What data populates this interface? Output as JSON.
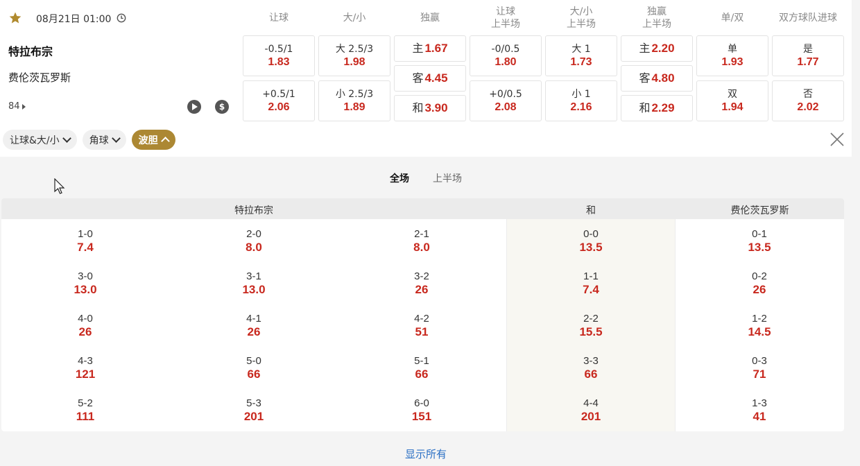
{
  "match": {
    "datetime": "08月21日 01:00",
    "home": "特拉布宗",
    "away": "费伦茨瓦罗斯",
    "markets_count": "84"
  },
  "columns": [
    {
      "l1": "让球",
      "l2": ""
    },
    {
      "l1": "大/小",
      "l2": ""
    },
    {
      "l1": "独赢",
      "l2": ""
    },
    {
      "l1": "让球",
      "l2": "上半场"
    },
    {
      "l1": "大/小",
      "l2": "上半场"
    },
    {
      "l1": "独赢",
      "l2": "上半场"
    },
    {
      "l1": "单/双",
      "l2": ""
    },
    {
      "l1": "双方球队进球",
      "l2": ""
    }
  ],
  "odds": {
    "handicap_full": [
      {
        "label": "-0.5/1",
        "value": "1.83"
      },
      {
        "label": "+0.5/1",
        "value": "2.06"
      }
    ],
    "ou_full": [
      {
        "label": "大 2.5/3",
        "value": "1.98"
      },
      {
        "label": "小 2.5/3",
        "value": "1.89"
      }
    ],
    "1x2_full": [
      {
        "label": "主",
        "value": "1.67"
      },
      {
        "label": "客",
        "value": "4.45"
      },
      {
        "label": "和",
        "value": "3.90"
      }
    ],
    "handicap_half": [
      {
        "label": "-0/0.5",
        "value": "1.80"
      },
      {
        "label": "+0/0.5",
        "value": "2.08"
      }
    ],
    "ou_half": [
      {
        "label": "大 1",
        "value": "1.73"
      },
      {
        "label": "小 1",
        "value": "2.16"
      }
    ],
    "1x2_half": [
      {
        "label": "主",
        "value": "2.20"
      },
      {
        "label": "客",
        "value": "4.80"
      },
      {
        "label": "和",
        "value": "2.29"
      }
    ],
    "odd_even": [
      {
        "label": "单",
        "value": "1.93"
      },
      {
        "label": "双",
        "value": "1.94"
      }
    ],
    "btts": [
      {
        "label": "是",
        "value": "1.77"
      },
      {
        "label": "否",
        "value": "2.02"
      }
    ]
  },
  "filters": [
    "让球&大/小",
    "角球",
    "波胆"
  ],
  "subtabs": [
    "全场",
    "上半场"
  ],
  "table": {
    "home_header": "特拉布宗",
    "draw_header": "和",
    "away_header": "费伦茨瓦罗斯",
    "rows": [
      [
        {
          "s": "1-0",
          "o": "7.4"
        },
        {
          "s": "2-0",
          "o": "8.0"
        },
        {
          "s": "2-1",
          "o": "8.0"
        },
        {
          "s": "0-0",
          "o": "13.5"
        },
        {
          "s": "0-1",
          "o": "13.5"
        }
      ],
      [
        {
          "s": "3-0",
          "o": "13.0"
        },
        {
          "s": "3-1",
          "o": "13.0"
        },
        {
          "s": "3-2",
          "o": "26"
        },
        {
          "s": "1-1",
          "o": "7.4"
        },
        {
          "s": "0-2",
          "o": "26"
        }
      ],
      [
        {
          "s": "4-0",
          "o": "26"
        },
        {
          "s": "4-1",
          "o": "26"
        },
        {
          "s": "4-2",
          "o": "51"
        },
        {
          "s": "2-2",
          "o": "15.5"
        },
        {
          "s": "1-2",
          "o": "14.5"
        }
      ],
      [
        {
          "s": "4-3",
          "o": "121"
        },
        {
          "s": "5-0",
          "o": "66"
        },
        {
          "s": "5-1",
          "o": "66"
        },
        {
          "s": "3-3",
          "o": "66"
        },
        {
          "s": "0-3",
          "o": "71"
        }
      ],
      [
        {
          "s": "5-2",
          "o": "111"
        },
        {
          "s": "5-3",
          "o": "201"
        },
        {
          "s": "6-0",
          "o": "151"
        },
        {
          "s": "4-4",
          "o": "201"
        },
        {
          "s": "1-3",
          "o": "41"
        }
      ]
    ]
  },
  "show_all": "显示所有",
  "colors": {
    "accent": "#ac8833",
    "odds": "#c8281e",
    "link": "#2a6fc4"
  }
}
